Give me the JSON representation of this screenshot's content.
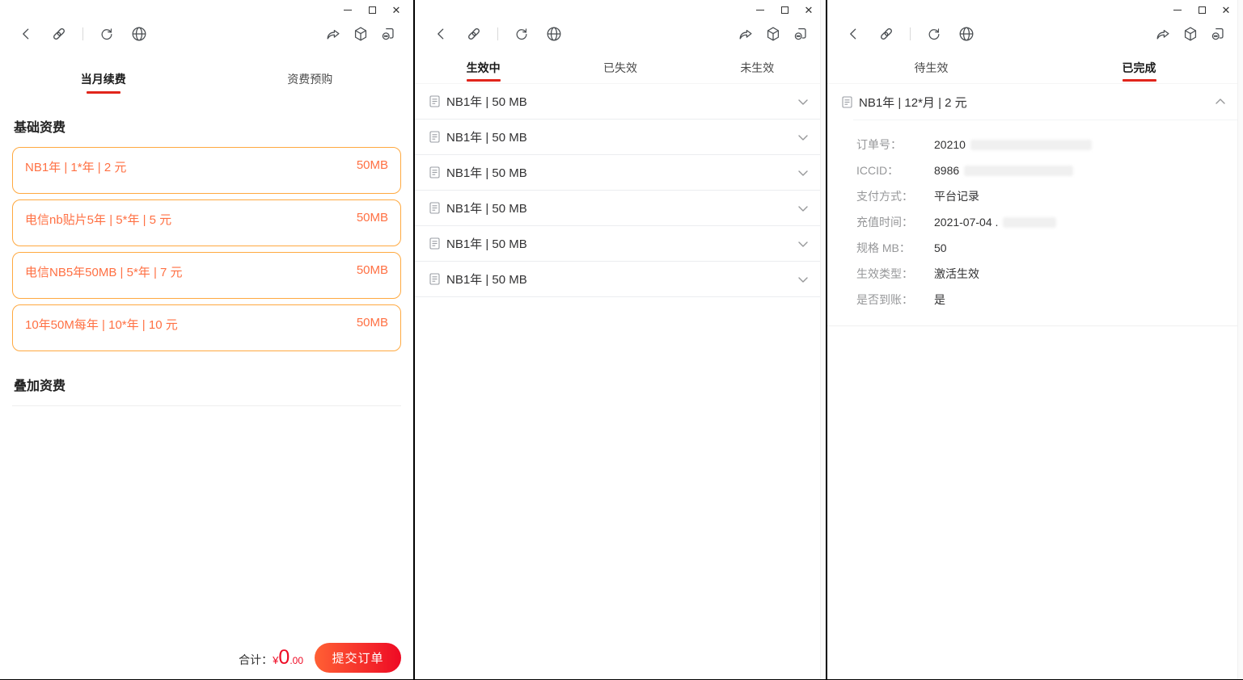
{
  "colors": {
    "accent_red": "#e1251b",
    "button_gradient": [
      "#ff6034",
      "#ee0a24"
    ],
    "card_border": "#ffa940",
    "card_text": "#ff7043"
  },
  "icons": {
    "minimize": "thin horizontal line",
    "maximize": "square outline",
    "close": "✕",
    "back": "‹ chevron",
    "link": "chain link",
    "refresh": "↻ circular arrow",
    "globe": "wireframe globe",
    "share": "curved forward arrow",
    "cube": "isometric package cube",
    "profile": "bracket with dotted circle",
    "document": "page with lines",
    "chevron_down": "⌄",
    "chevron_up": "⌃"
  },
  "windows": [
    {
      "tabs": [
        {
          "label": "当月续费",
          "active": true
        },
        {
          "label": "资费预购",
          "active": false
        }
      ],
      "sections": [
        {
          "title": "基础资费",
          "cards": [
            {
              "title": "NB1年 | 1*年 | 2 元",
              "size": "50MB"
            },
            {
              "title": "电信nb贴片5年 | 5*年 | 5 元",
              "size": "50MB"
            },
            {
              "title": "电信NB5年50MB | 5*年 | 7 元",
              "size": "50MB"
            },
            {
              "title": "10年50M每年 | 10*年 | 10 元",
              "size": "50MB"
            }
          ]
        },
        {
          "title": "叠加资费",
          "cards": []
        }
      ],
      "footer": {
        "total_label": "合计：",
        "currency": "¥",
        "amount_int": "0",
        "amount_dec": ".00",
        "submit_label": "提交订单"
      }
    },
    {
      "tabs": [
        {
          "label": "生效中",
          "active": true
        },
        {
          "label": "已失效",
          "active": false
        },
        {
          "label": "未生效",
          "active": false
        }
      ],
      "items": [
        {
          "title": "NB1年 | 50 MB"
        },
        {
          "title": "NB1年 | 50 MB"
        },
        {
          "title": "NB1年 | 50 MB"
        },
        {
          "title": "NB1年 | 50 MB"
        },
        {
          "title": "NB1年 | 50 MB"
        },
        {
          "title": "NB1年 | 50 MB"
        }
      ]
    },
    {
      "tabs": [
        {
          "label": "待生效",
          "active": false
        },
        {
          "label": "已完成",
          "active": true
        }
      ],
      "item": {
        "title": "NB1年 | 12*月 | 2 元"
      },
      "details": [
        {
          "label": "订单号：",
          "value": "20210",
          "redacted": true
        },
        {
          "label": "ICCID：",
          "value": "8986",
          "redacted": true
        },
        {
          "label": "支付方式：",
          "value": "平台记录",
          "redacted": false
        },
        {
          "label": "充值时间：",
          "value": "2021-07-04 .",
          "redacted": true
        },
        {
          "label": "规格 MB：",
          "value": "50",
          "redacted": false
        },
        {
          "label": "生效类型：",
          "value": "激活生效",
          "redacted": false
        },
        {
          "label": "是否到账：",
          "value": "是",
          "redacted": false
        }
      ]
    }
  ]
}
